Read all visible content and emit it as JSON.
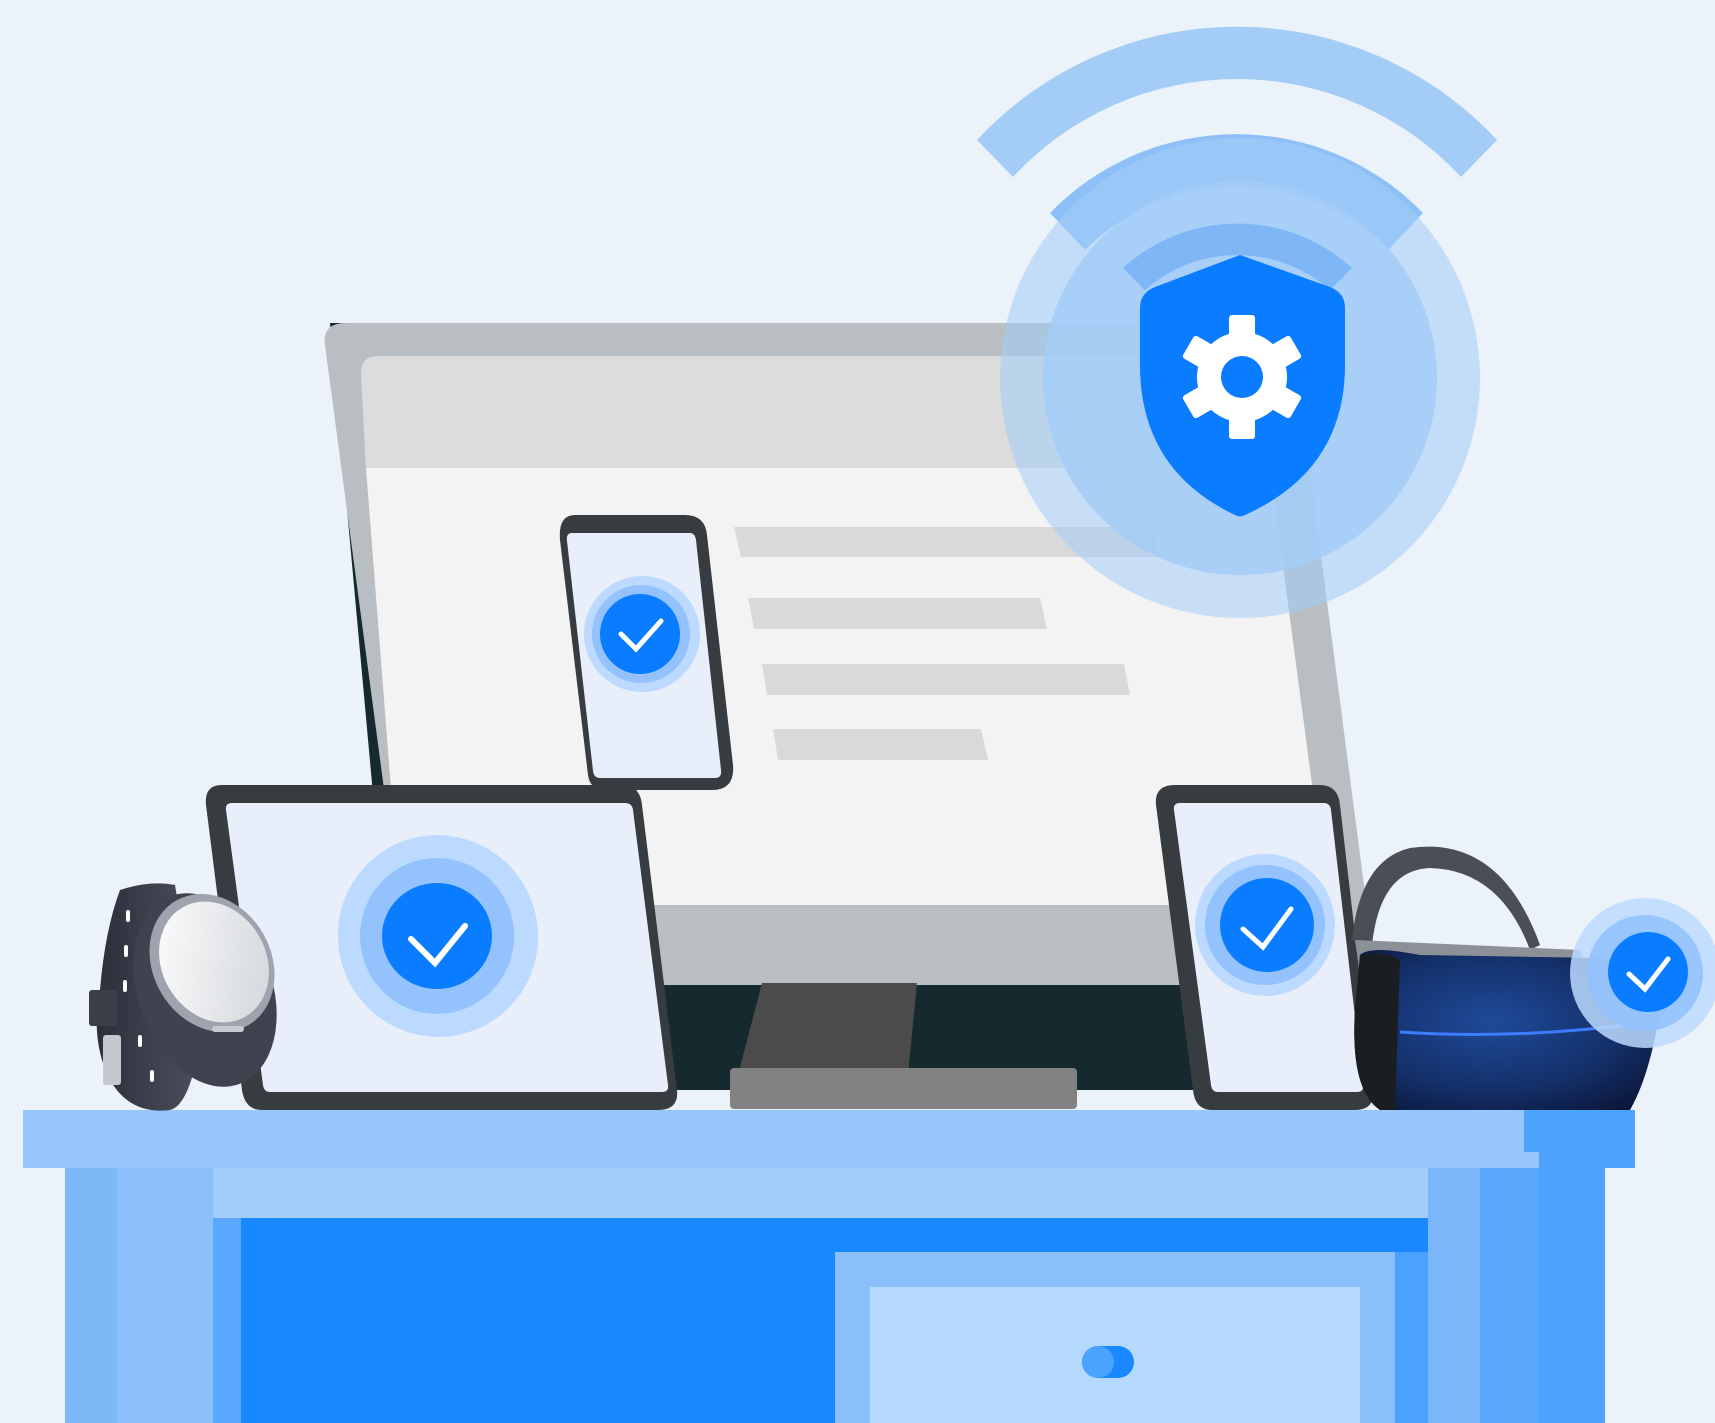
{
  "colors": {
    "background": "#ebf2fa",
    "accent": "#0a7cff",
    "accent_light": "#a3ccf7",
    "desk_top": "#96c6fa",
    "desk_front": "#1a88ff",
    "monitor_bezel": "#b9bec2",
    "screen": "#f3f3f3",
    "check_white": "#ffffff"
  },
  "icons": {
    "shield": "shield-gear-icon",
    "check": "check-badge-icon",
    "signal": "wifi-signal-icon",
    "drawer_handle": "toggle-handle-icon"
  },
  "scene": {
    "devices": [
      "monitor",
      "phone-on-screen",
      "tablet",
      "smartwatch",
      "phone",
      "vr-headset"
    ],
    "verified_devices": [
      "phone-on-screen",
      "tablet",
      "phone",
      "vr-headset"
    ],
    "furniture": "desk"
  }
}
